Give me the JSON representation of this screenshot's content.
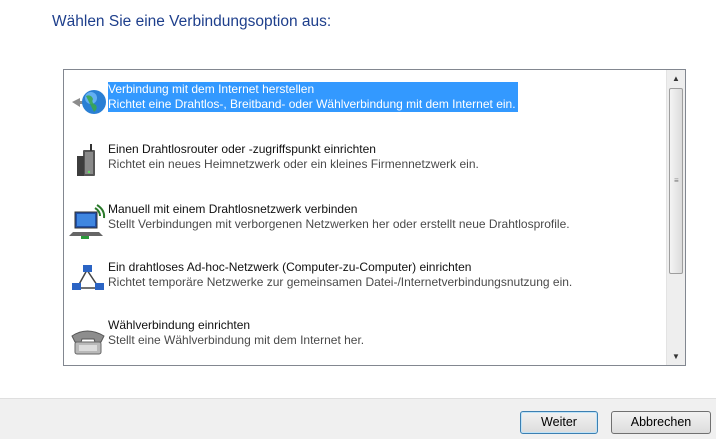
{
  "heading": "Wählen Sie eine Verbindungsoption aus:",
  "options": [
    {
      "title": "Verbindung mit dem Internet herstellen",
      "description": "Richtet eine Drahtlos-, Breitband- oder Wählverbindung mit dem Internet ein.",
      "icon": "globe-network-icon",
      "selected": true
    },
    {
      "title": "Einen Drahtlosrouter oder -zugriffspunkt einrichten",
      "description": "Richtet ein neues Heimnetzwerk oder ein kleines Firmennetzwerk ein.",
      "icon": "wireless-router-icon",
      "selected": false
    },
    {
      "title": "Manuell mit einem Drahtlosnetzwerk verbinden",
      "description": "Stellt Verbindungen mit verborgenen Netzwerken her oder erstellt neue Drahtlosprofile.",
      "icon": "wireless-network-icon",
      "selected": false
    },
    {
      "title": "Ein drahtloses Ad-hoc-Netzwerk (Computer-zu-Computer) einrichten",
      "description": "Richtet temporäre Netzwerke zur gemeinsamen Datei-/Internetverbindungsnutzung ein.",
      "icon": "adhoc-network-icon",
      "selected": false
    },
    {
      "title": "Wählverbindung einrichten",
      "description": "Stellt eine Wählverbindung mit dem Internet her.",
      "icon": "dialup-phone-icon",
      "selected": false
    }
  ],
  "buttons": {
    "next": "Weiter",
    "cancel": "Abbrechen"
  },
  "colors": {
    "heading": "#1e3f8c",
    "selection": "#3399ff",
    "footer": "#f0f0f0"
  }
}
